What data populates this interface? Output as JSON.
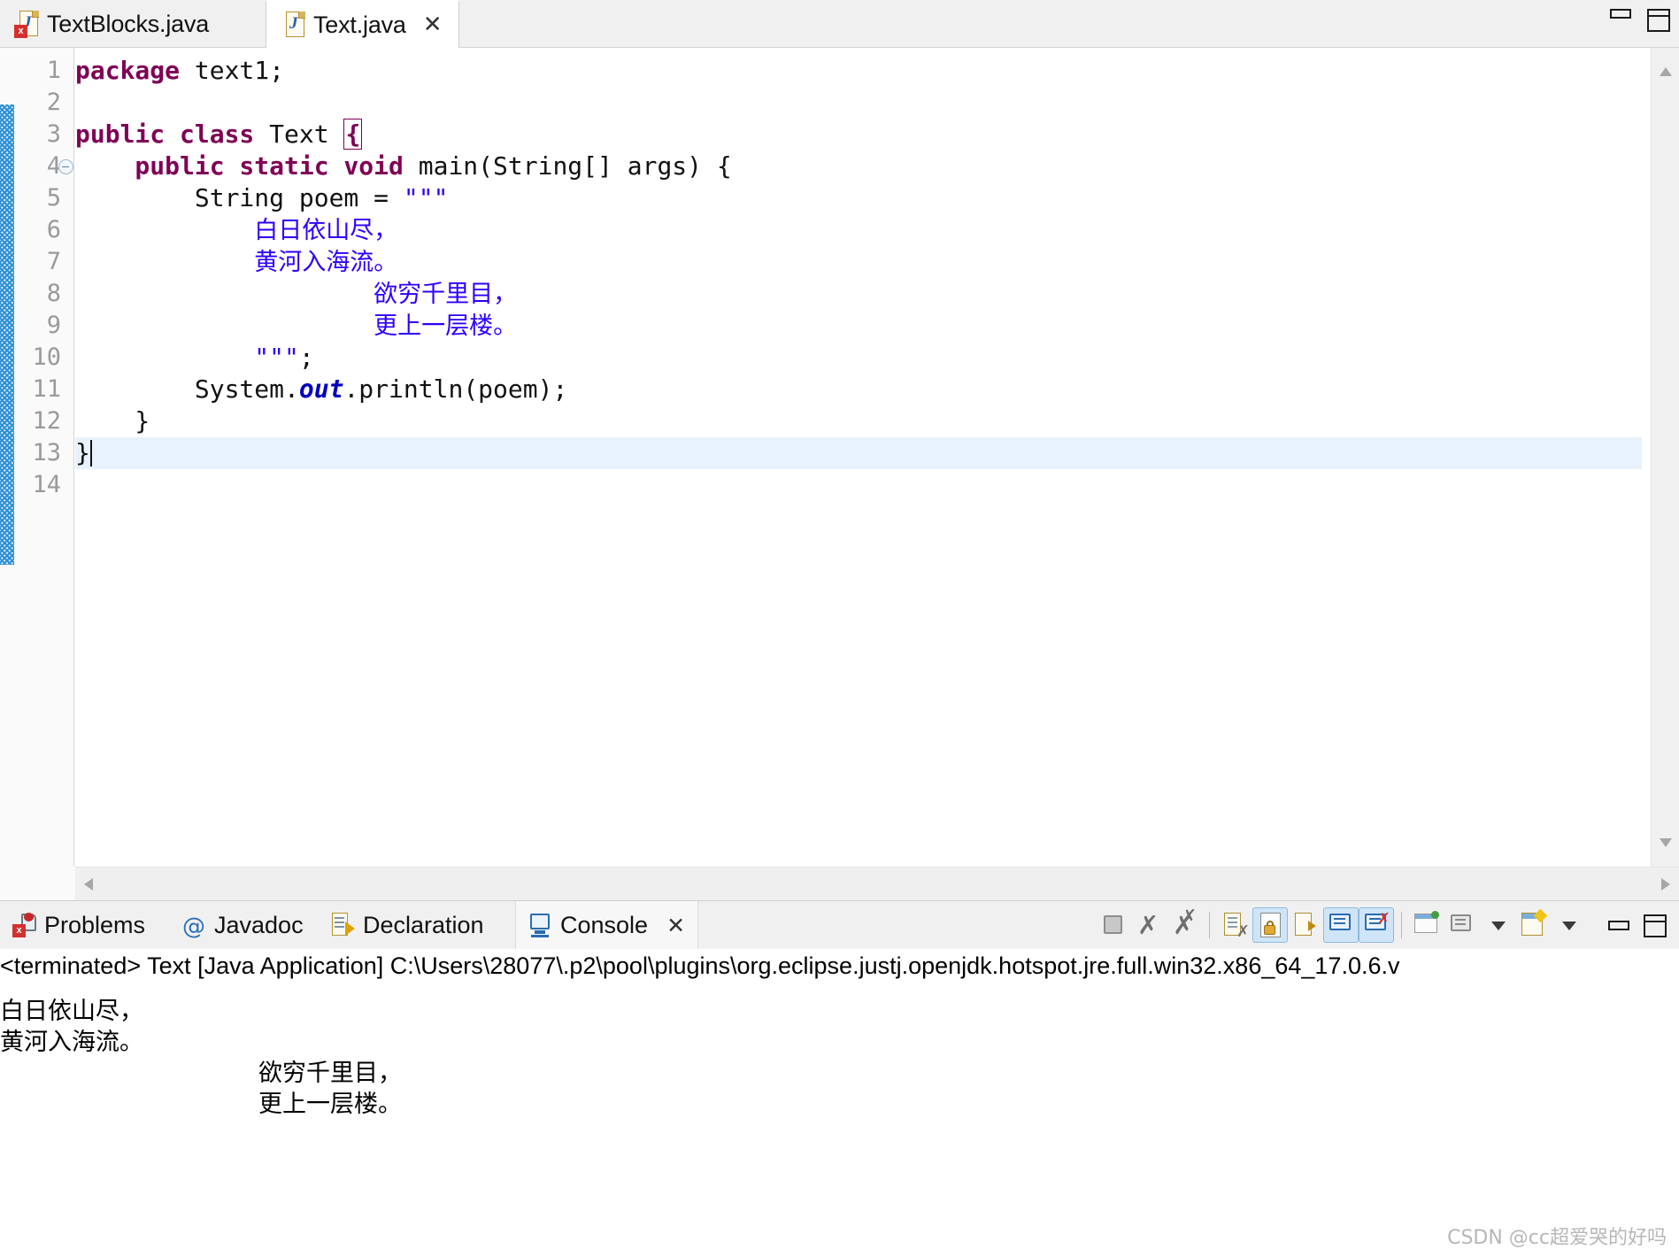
{
  "window": {
    "minimize_label": "minimize",
    "maximize_label": "maximize"
  },
  "editor_tabs": [
    {
      "label": "TextBlocks.java",
      "icon": "java-file-error-icon",
      "active": false,
      "closable": false
    },
    {
      "label": "Text.java",
      "icon": "java-file-icon",
      "active": true,
      "closable": true,
      "close_glyph": "✕"
    }
  ],
  "editor": {
    "highlighted_line": 13,
    "line_numbers": [
      "1",
      "2",
      "3",
      "4",
      "5",
      "6",
      "7",
      "8",
      "9",
      "10",
      "11",
      "12",
      "13",
      "14"
    ],
    "fold_marker_line": 4,
    "lines": [
      {
        "n": "1",
        "segments": [
          {
            "t": "package ",
            "c": "kw"
          },
          {
            "t": "text1;",
            "c": "plain"
          }
        ]
      },
      {
        "n": "2",
        "segments": []
      },
      {
        "n": "3",
        "segments": [
          {
            "t": "public class ",
            "c": "kw"
          },
          {
            "t": "Text ",
            "c": "plain"
          },
          {
            "t": "{",
            "c": "brace"
          }
        ]
      },
      {
        "n": "4",
        "segments": [
          {
            "t": "    public static void ",
            "c": "kw"
          },
          {
            "t": "main(String[] args) {",
            "c": "plain"
          }
        ]
      },
      {
        "n": "5",
        "segments": [
          {
            "t": "        String poem = ",
            "c": "plain"
          },
          {
            "t": "\"\"\"",
            "c": "str"
          }
        ]
      },
      {
        "n": "6",
        "segments": [
          {
            "t": "            ",
            "c": "plain"
          },
          {
            "t": "白日依山尽，",
            "c": "cjk"
          }
        ]
      },
      {
        "n": "7",
        "segments": [
          {
            "t": "            ",
            "c": "plain"
          },
          {
            "t": "黄河入海流。",
            "c": "cjk"
          }
        ]
      },
      {
        "n": "8",
        "segments": [
          {
            "t": "                    ",
            "c": "plain"
          },
          {
            "t": "欲穷千里目，",
            "c": "cjk"
          }
        ]
      },
      {
        "n": "9",
        "segments": [
          {
            "t": "                    ",
            "c": "plain"
          },
          {
            "t": "更上一层楼。",
            "c": "cjk"
          }
        ]
      },
      {
        "n": "10",
        "segments": [
          {
            "t": "            ",
            "c": "plain"
          },
          {
            "t": "\"\"\"",
            "c": "str"
          },
          {
            "t": ";",
            "c": "plain"
          }
        ]
      },
      {
        "n": "11",
        "segments": [
          {
            "t": "        System.",
            "c": "plain"
          },
          {
            "t": "out",
            "c": "fld"
          },
          {
            "t": ".println(poem);",
            "c": "plain"
          }
        ]
      },
      {
        "n": "12",
        "segments": [
          {
            "t": "    }",
            "c": "plain"
          }
        ]
      },
      {
        "n": "13",
        "segments": [
          {
            "t": "}",
            "c": "plain"
          },
          {
            "t": "",
            "c": "caret"
          }
        ]
      },
      {
        "n": "14",
        "segments": []
      }
    ],
    "scroll": {
      "vertical_up": "scroll-up",
      "vertical_down": "scroll-down",
      "horizontal_left": "scroll-left",
      "horizontal_right": "scroll-right"
    }
  },
  "colors": {
    "keyword": "#7f0055",
    "string": "#2a00ff",
    "field": "#0000c0",
    "line_highlight": "#e8f2fd",
    "change_bar": "#2e8fd6",
    "gutter_text": "#9a9a9a"
  },
  "panel": {
    "tabs": [
      {
        "label": "Problems",
        "icon": "problems-icon",
        "active": false
      },
      {
        "label": "Javadoc",
        "icon": "at-icon",
        "active": false
      },
      {
        "label": "Declaration",
        "icon": "declaration-icon",
        "active": false
      },
      {
        "label": "Console",
        "icon": "console-icon",
        "active": true,
        "close_glyph": "✕"
      }
    ],
    "toolbar": [
      {
        "name": "terminate-button",
        "tooltip": "Terminate",
        "selected": false
      },
      {
        "name": "remove-launch-button",
        "tooltip": "Remove Launch",
        "selected": false
      },
      {
        "name": "remove-all-terminated-button",
        "tooltip": "Remove All Terminated Launches",
        "selected": false
      },
      {
        "name": "clear-console-button",
        "tooltip": "Clear Console",
        "selected": false
      },
      {
        "name": "scroll-lock-button",
        "tooltip": "Scroll Lock",
        "selected": true
      },
      {
        "name": "word-wrap-button",
        "tooltip": "Word Wrap",
        "selected": false
      },
      {
        "name": "show-console-on-output-button",
        "tooltip": "Show Console When Standard Out Changes",
        "selected": true
      },
      {
        "name": "show-console-on-error-button",
        "tooltip": "Show Console When Standard Error Changes",
        "selected": true
      },
      {
        "name": "pin-console-button",
        "tooltip": "Pin Console",
        "selected": false
      },
      {
        "name": "display-selected-console-button",
        "tooltip": "Display Selected Console",
        "selected": false
      },
      {
        "name": "display-selected-console-dropdown",
        "tooltip": "Display Selected Console menu",
        "selected": false
      },
      {
        "name": "open-console-button",
        "tooltip": "Open Console",
        "selected": false
      },
      {
        "name": "open-console-dropdown",
        "tooltip": "Open Console menu",
        "selected": false
      },
      {
        "name": "minimize-panel-button",
        "tooltip": "Minimize",
        "selected": false
      },
      {
        "name": "maximize-panel-button",
        "tooltip": "Maximize",
        "selected": false
      }
    ],
    "console": {
      "status_line": "<terminated> Text [Java Application] C:\\Users\\28077\\.p2\\pool\\plugins\\org.eclipse.justj.openjdk.hotspot.jre.full.win32.x86_64_17.0.6.v",
      "output_lines": [
        {
          "text": "白日依山尽，",
          "indent": 0
        },
        {
          "text": "黄河入海流。",
          "indent": 0
        },
        {
          "text": "欲穷千里目，",
          "indent": 292
        },
        {
          "text": "更上一层楼。",
          "indent": 292
        }
      ]
    }
  },
  "watermark": "CSDN @cc超爱哭的好吗"
}
